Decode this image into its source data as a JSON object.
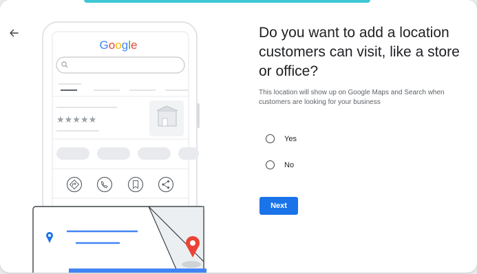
{
  "header": {
    "back_icon": "arrow-left-icon"
  },
  "illustration": {
    "logo_text": "Google",
    "rating_stars": "★★★★★",
    "action_icons": [
      "directions-icon",
      "phone-icon",
      "bookmark-icon",
      "share-icon"
    ],
    "colors": {
      "logo_blue": "#4285f4",
      "logo_red": "#ea4335",
      "logo_yellow": "#fbbc05",
      "logo_green": "#34a853",
      "pin_red": "#ea4335",
      "pin_blue": "#1a73e8"
    }
  },
  "main": {
    "question": "Do you want to add a location customers can visit, like a store or office?",
    "description": "This location will show up on Google Maps and Search when customers are looking for your business",
    "options": [
      {
        "label": "Yes",
        "selected": false
      },
      {
        "label": "No",
        "selected": false
      }
    ],
    "next_label": "Next"
  },
  "colors": {
    "accent": "#1a73e8",
    "top_accent": "#3ec8d6"
  }
}
